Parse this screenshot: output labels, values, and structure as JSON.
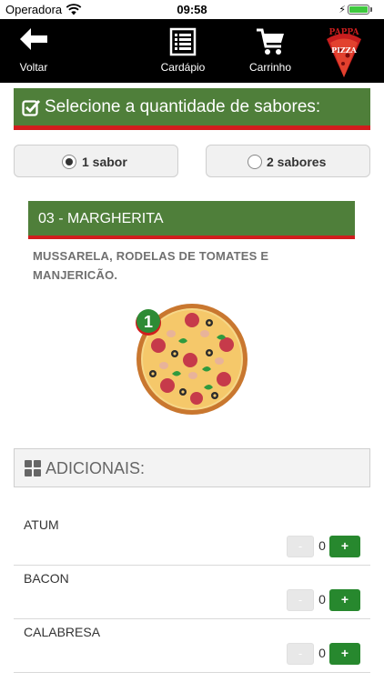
{
  "status_bar": {
    "carrier": "Operadora",
    "time": "09:58"
  },
  "nav": {
    "back_label": "Voltar",
    "menu_label": "Cardápio",
    "cart_label": "Carrinho",
    "logo_text": "PAPPA PIZZA"
  },
  "flavors_section": {
    "title": "Selecione a quantidade de sabores:",
    "options": [
      {
        "label": "1 sabor",
        "selected": true
      },
      {
        "label": "2 sabores",
        "selected": false
      }
    ]
  },
  "selected_flavor": {
    "name": "03 - MARGHERITA",
    "description": "MUSSARELA, RODELAS DE TOMATES E MANJERICÃO.",
    "slice_badge": "1"
  },
  "additions": {
    "title": "ADICIONAIS:",
    "minus_label": "-",
    "plus_label": "+",
    "items": [
      {
        "name": "ATUM",
        "quantity": "0"
      },
      {
        "name": "BACON",
        "quantity": "0"
      },
      {
        "name": "CALABRESA",
        "quantity": "0"
      }
    ]
  },
  "colors": {
    "header_green": "#4f7f3a",
    "accent_red": "#d11d1d",
    "plus_green": "#27882e"
  }
}
